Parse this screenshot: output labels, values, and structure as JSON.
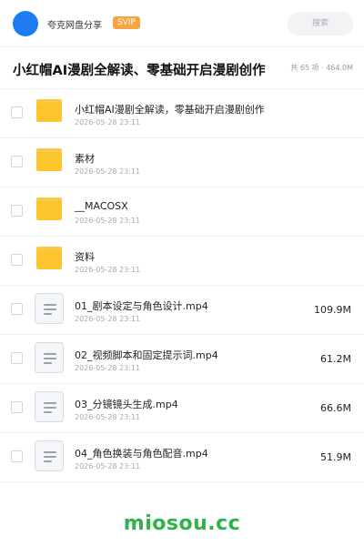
{
  "header": {
    "share_name": "夸克网盘分享",
    "vip_badge": "SVIP",
    "search_label": "搜索"
  },
  "title_bar": {
    "title": "小红帽AI漫剧全解读、零基础开启漫剧创作",
    "summary": "共 65 项 · 464.0M"
  },
  "files": [
    {
      "name": "小红帽AI漫剧全解读，零基础开启漫剧创作",
      "date": "2026-05-28 23:11",
      "type": "folder",
      "size": ""
    },
    {
      "name": "素材",
      "date": "2026-05-28 23:11",
      "type": "folder",
      "size": ""
    },
    {
      "name": "__MACOSX",
      "date": "2026-05-28 23:11",
      "type": "folder",
      "size": ""
    },
    {
      "name": "资料",
      "date": "2026-05-28 23:11",
      "type": "folder",
      "size": ""
    },
    {
      "name": "01_剧本设定与角色设计.mp4",
      "date": "2026-05-28 23:11",
      "type": "video",
      "size": "109.9M"
    },
    {
      "name": "02_视频脚本和固定提示词.mp4",
      "date": "2026-05-28 23:11",
      "type": "video",
      "size": "61.2M"
    },
    {
      "name": "03_分镜镜头生成.mp4",
      "date": "2026-05-28 23:11",
      "type": "video",
      "size": "66.6M"
    },
    {
      "name": "04_角色换装与角色配音.mp4",
      "date": "2026-05-28 23:11",
      "type": "video",
      "size": "51.9M"
    }
  ],
  "watermark": "miosou.cc",
  "colors": {
    "avatar": "#1e7bf2",
    "vip_badge": "#f7a541",
    "folder": "#fcc42d",
    "watermark": "#2fb24a"
  }
}
